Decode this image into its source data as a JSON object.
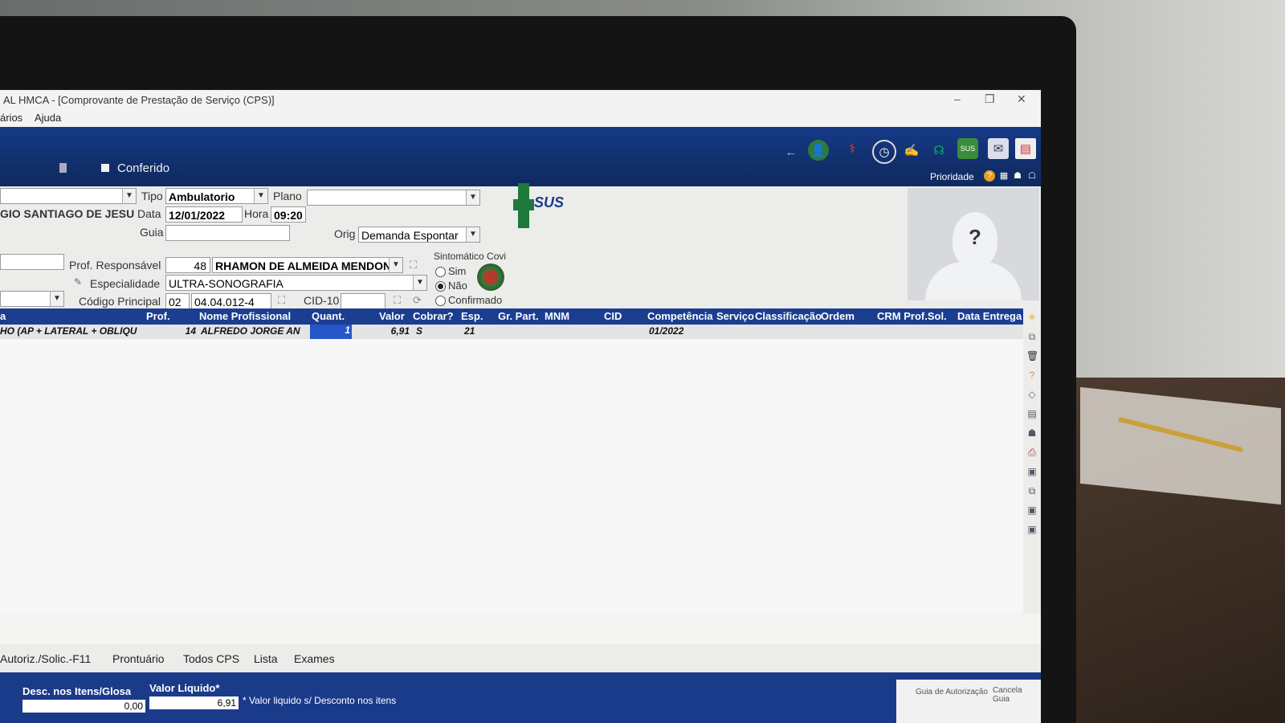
{
  "window": {
    "title": "AL HMCA - [Comprovante de Prestação de Serviço  (CPS)]",
    "controls": [
      "–",
      "❐",
      "✕"
    ]
  },
  "menu": [
    "ários",
    "Ajuda"
  ],
  "toolbar": {
    "conferido": "Conferido",
    "prioridade": "Prioridade"
  },
  "form": {
    "tipo_label": "Tipo",
    "tipo_value": "Ambulatorio",
    "plano_label": "Plano",
    "plano_value": "",
    "patient_name": "GIO SANTIAGO DE JESU",
    "data_label": "Data",
    "data_value": "12/01/2022",
    "hora_label": "Hora",
    "hora_value": "09:20",
    "guia_label": "Guia",
    "guia_value": "",
    "orig_label": "Orig",
    "orig_value": "Demanda Espontar",
    "sus_text": "SUS",
    "sintomatico_label": "Sintomático Covi",
    "sintomatico_options": [
      "Sim",
      "Não",
      "Confirmado"
    ],
    "sintomatico_selected": "Não",
    "prof_resp_label": "Prof. Responsável",
    "prof_resp_code": "48",
    "prof_resp_name": "RHAMON DE ALMEIDA MENDON",
    "especialidade_label": "Especialidade",
    "especialidade_value": "ULTRA-SONOGRAFIA",
    "codigo_label": "Código Principal",
    "codigo_prefix": "02",
    "codigo_value": "04.04.012-4",
    "cid_label": "CID-10",
    "cid_value": ""
  },
  "grid": {
    "headers": [
      "a",
      "Prof.",
      "Nome Profissional",
      "Quant.",
      "Valor",
      "Cobrar?",
      "Esp.",
      "Gr. Part.",
      "MNM",
      "CID",
      "Competência",
      "Serviço",
      "Classificação",
      "Ordem",
      "CRM Prof.Sol.",
      "Data Entrega"
    ],
    "rows": [
      {
        "procedure": "HO (AP + LATERAL + OBLIQU",
        "prof": "14",
        "nome": "ALFREDO JORGE AN",
        "quant": "1",
        "valor": "6,91",
        "cobrar": "S",
        "esp": "21",
        "competencia": "01/2022"
      }
    ]
  },
  "tabs": [
    "Autoriz./Solic.-F11",
    "Prontuário",
    "Todos CPS",
    "Lista",
    "Exames"
  ],
  "footer": {
    "desc_label": "Desc. nos Itens/Glosa",
    "desc_value": "0,00",
    "liquido_label": "Valor Liquido*",
    "liquido_value": "6,91",
    "note": "* Valor liquido s/ Desconto nos itens",
    "guia_autorizacao": "Guia de Autorização",
    "cancela_guia": "Cancela Guia"
  }
}
